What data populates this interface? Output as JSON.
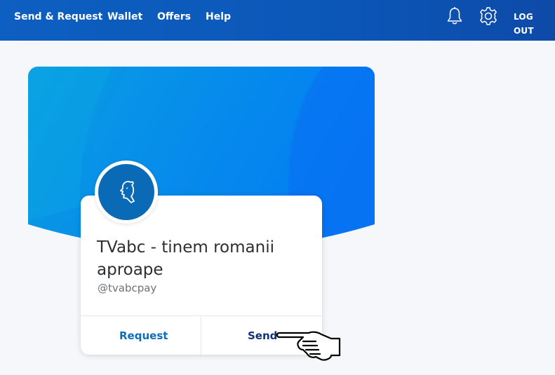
{
  "nav": {
    "items": [
      {
        "label": "Send & Request"
      },
      {
        "label": "Wallet"
      },
      {
        "label": "Offers"
      },
      {
        "label": "Help"
      }
    ],
    "logout_label": "LOG OUT",
    "notifications_icon": "bell-icon",
    "settings_icon": "gear-icon"
  },
  "profile": {
    "name": "TVabc - tinem romanii aproape",
    "handle": "@tvabcpay",
    "avatar_icon": "profile-silhouette-icon"
  },
  "actions": {
    "request_label": "Request",
    "send_label": "Send"
  },
  "pointer_icon": "pointing-hand-cursor-icon",
  "colors": {
    "nav_bg": "#0b57b8",
    "banner_start": "#0aa0e0",
    "banner_end": "#0277f5",
    "avatar_bg": "#0a6ab6",
    "request_text": "#0c6db8",
    "send_text": "#12337a"
  }
}
